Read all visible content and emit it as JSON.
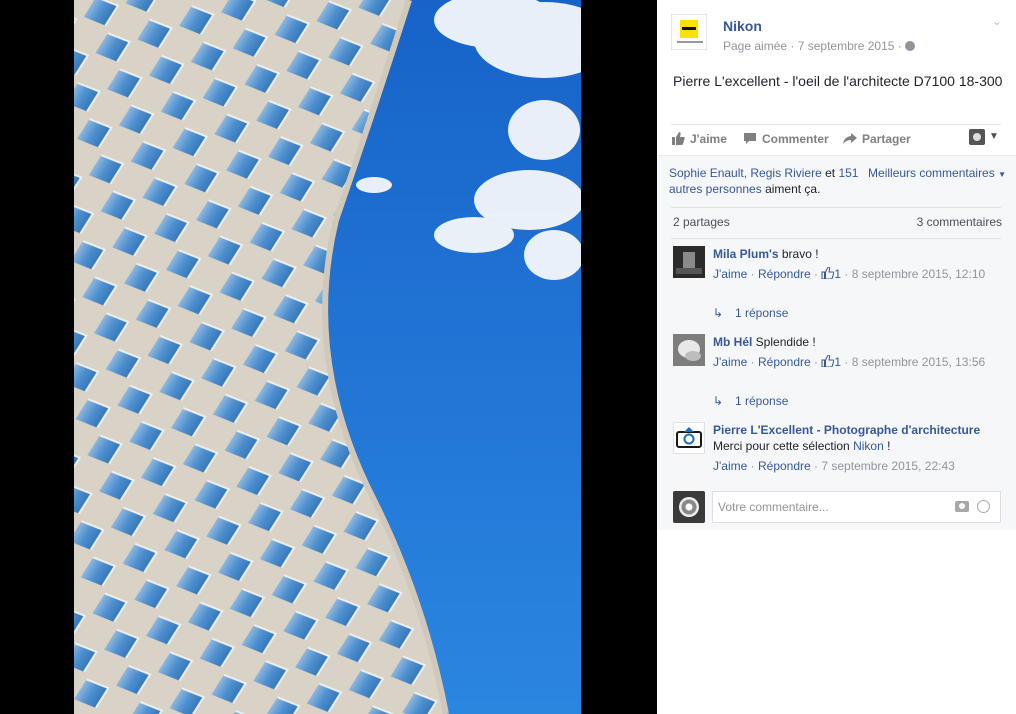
{
  "page": {
    "name": "Nikon",
    "meta": "Page aimée · 7 septembre 2015 ·",
    "logo": "nikon-logo"
  },
  "post": {
    "text": "Pierre L'excellent - l'oeil de l'architecte D7100 18-300"
  },
  "actions": {
    "like": "J'aime",
    "comment": "Commenter",
    "share": "Partager"
  },
  "feedback": {
    "likes_names": "Sophie Enault, Regis Riviere",
    "likes_and": " et ",
    "likes_others": "151 autres personnes",
    "likes_suffix": " aiment ça.",
    "sort_label": "Meilleurs commentaires",
    "shares": "2 partages",
    "comments_count": "3 commentaires"
  },
  "comments": [
    {
      "author": "Mila Plum's",
      "text": " bravo !",
      "like_label": "J'aime",
      "reply_label": "Répondre",
      "like_count": "1",
      "date": "8 septembre 2015, 12:10",
      "replies": "1 réponse"
    },
    {
      "author": "Mb Hél",
      "text": " Splendide !",
      "like_label": "J'aime",
      "reply_label": "Répondre",
      "like_count": "1",
      "date": "8 septembre 2015, 13:56",
      "replies": "1 réponse"
    },
    {
      "author": "Pierre L'Excellent - Photographe d'architecture",
      "text_prefix": "Merci pour cette sélection ",
      "mention": "Nikon",
      "text_suffix": " !",
      "like_label": "J'aime",
      "reply_label": "Répondre",
      "date": "7 septembre 2015, 22:43"
    }
  ],
  "composer": {
    "placeholder": "Votre commentaire..."
  },
  "colors": {
    "link": "#365899",
    "meta": "#90949c",
    "sky": "#1f73d6",
    "panel_bg": "#f6f7f9"
  }
}
